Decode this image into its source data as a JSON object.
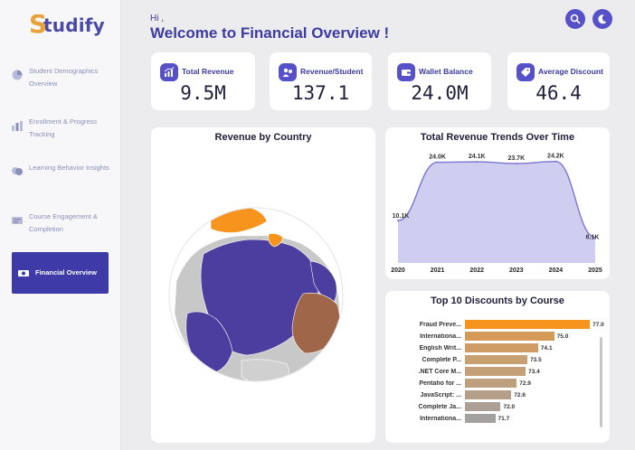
{
  "brand": {
    "logo_initial": "S",
    "logo_rest": "tudify"
  },
  "sidebar": {
    "items": [
      {
        "label": "Student Demographics Overview",
        "icon": "pie-chart-icon"
      },
      {
        "label": "Enrollment & Progress Tracking",
        "icon": "bar-chart-icon"
      },
      {
        "label": "Learning Behavior Insights",
        "icon": "brain-icon"
      },
      {
        "label": "Course Engagement & Completion",
        "icon": "engagement-icon"
      },
      {
        "label": "Financial Overview",
        "icon": "financial-icon",
        "active": true
      }
    ]
  },
  "header": {
    "greeting": "Hi ,",
    "title": "Welcome to Financial Overview !"
  },
  "kpis": [
    {
      "title": "Total Revenue",
      "value": "9.5M",
      "icon": "chart-up-icon"
    },
    {
      "title": "Revenue/Student",
      "value": "137.1",
      "icon": "student-money-icon"
    },
    {
      "title": "Wallet Balance",
      "value": "24.0M",
      "icon": "wallet-icon"
    },
    {
      "title": "Average Discount",
      "value": "46.4",
      "icon": "discount-tag-icon"
    }
  ],
  "map": {
    "title": "Revenue by Country"
  },
  "colors": {
    "accent": "#5650c9",
    "primary": "#3e3aa8",
    "orange": "#f7941d",
    "area": "#cfcdf0",
    "line": "#7b76cf"
  },
  "chart_data": [
    {
      "type": "area",
      "title": "Total Revenue Trends Over Time",
      "x": [
        "2020",
        "2021",
        "2022",
        "2023",
        "2024",
        "2025"
      ],
      "values": [
        10.1,
        24.0,
        24.1,
        23.7,
        24.2,
        6.1
      ],
      "data_labels": [
        "10.1K",
        "24.0K",
        "24.1K",
        "23.7K",
        "24.2K",
        "6.1K"
      ],
      "ylim": [
        0,
        28
      ],
      "grid": false
    },
    {
      "type": "bar",
      "orientation": "horizontal",
      "title": "Top 10 Discounts by Course",
      "categories": [
        "Fraud Preve...",
        "Internationa...",
        "English Writ...",
        "Complete P...",
        ".NET Core M...",
        "Pentaho for ...",
        "JavaScript: ...",
        "Complete Ja...",
        "Internationa..."
      ],
      "values": [
        77.0,
        75.0,
        74.1,
        73.5,
        73.4,
        72.9,
        72.6,
        72.0,
        71.7
      ],
      "colors": [
        "#f7941d",
        "#d69a58",
        "#ce9c64",
        "#c9a071",
        "#c59f76",
        "#bfa07e",
        "#b69f88",
        "#ac9f95",
        "#a3a09f"
      ],
      "xlim": [
        70,
        77.5
      ]
    }
  ]
}
